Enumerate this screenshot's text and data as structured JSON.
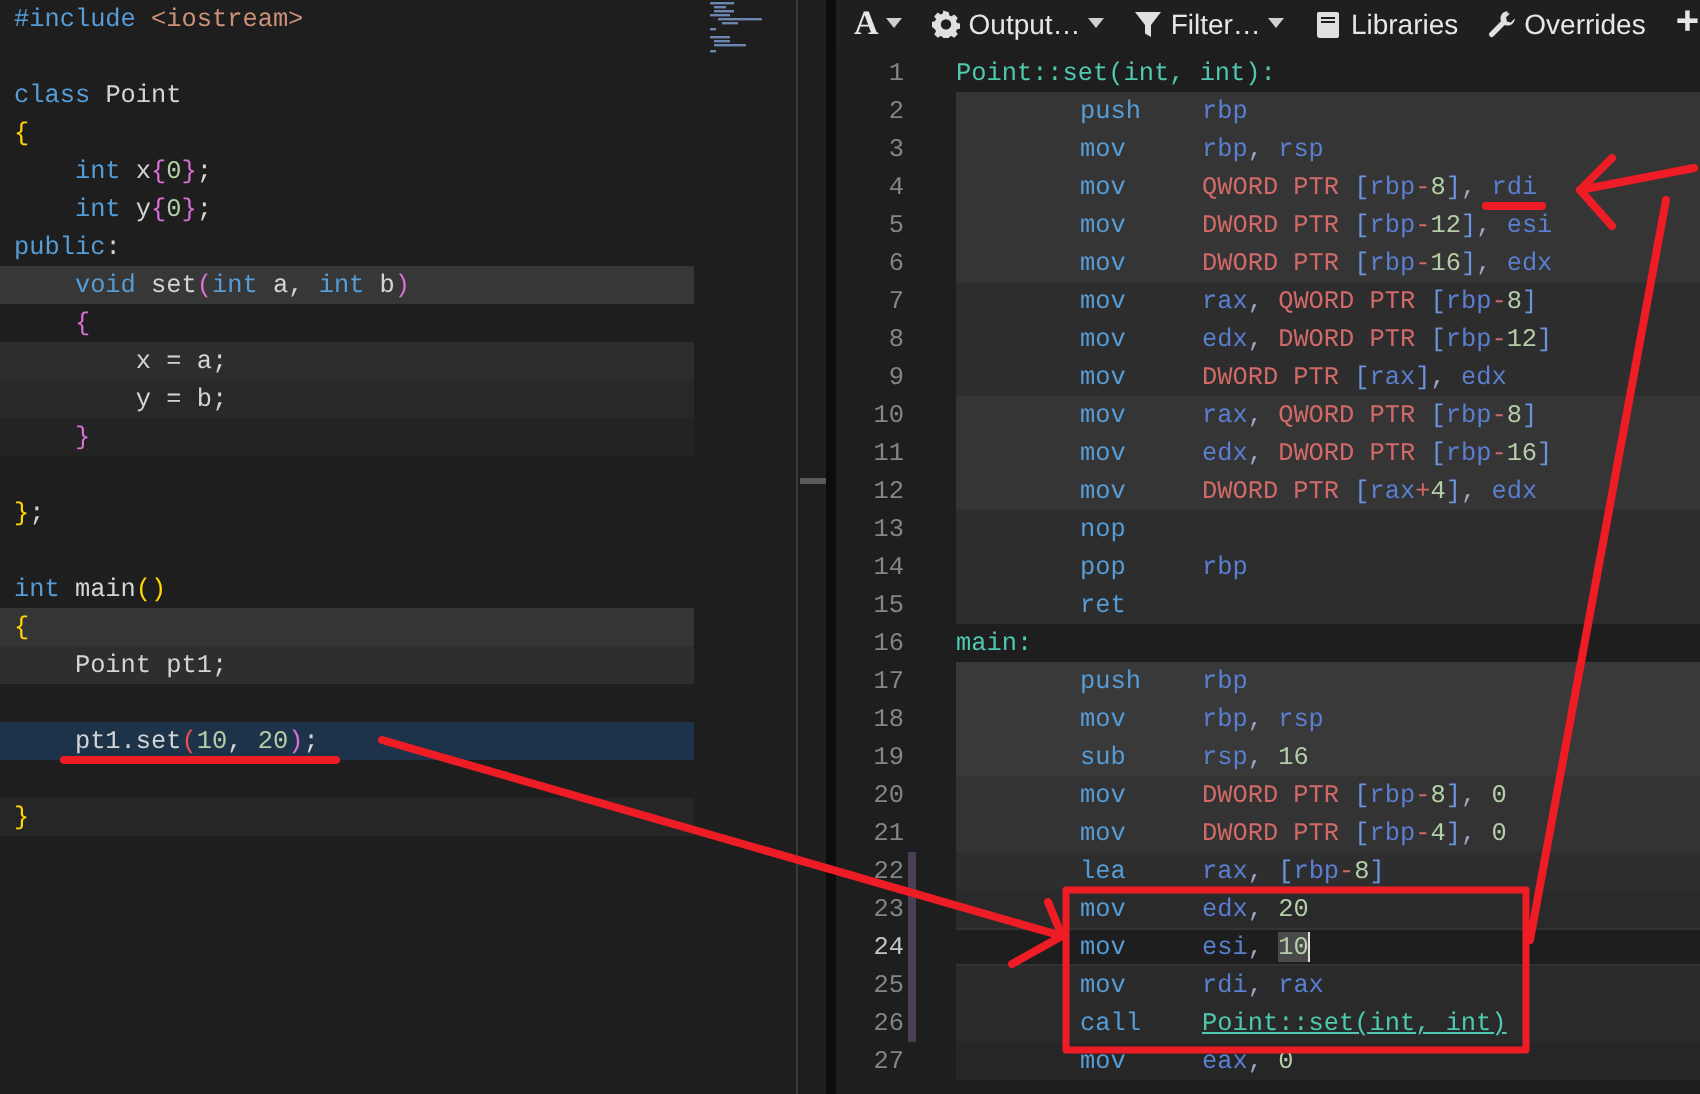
{
  "editor": {
    "lines": [
      {
        "selected": false,
        "tokens": [
          {
            "text": "#include",
            "kind": "kw"
          },
          {
            "text": " <iostream>",
            "kind": "inc"
          }
        ]
      },
      {
        "selected": false
      },
      {
        "selected": false,
        "tokens": [
          {
            "text": "class",
            "kind": "kw"
          },
          {
            "text": " Point",
            "kind": "plain"
          }
        ]
      },
      {
        "selected": false,
        "tokens": [
          {
            "text": "{",
            "kind": "gold"
          }
        ]
      },
      {
        "selected": false,
        "tokens": [
          {
            "text": "    int",
            "kind": "kw"
          },
          {
            "text": " x",
            "kind": "plain"
          },
          {
            "text": "{",
            "kind": "pink"
          },
          {
            "text": "0",
            "kind": "num"
          },
          {
            "text": "}",
            "kind": "pink"
          },
          {
            "text": ";",
            "kind": "plain"
          }
        ]
      },
      {
        "selected": false,
        "tokens": [
          {
            "text": "    int",
            "kind": "kw"
          },
          {
            "text": " y",
            "kind": "plain"
          },
          {
            "text": "{",
            "kind": "pink"
          },
          {
            "text": "0",
            "kind": "num"
          },
          {
            "text": "}",
            "kind": "pink"
          },
          {
            "text": ";",
            "kind": "plain"
          }
        ]
      },
      {
        "selected": false,
        "tokens": [
          {
            "text": "public",
            "kind": "kw"
          },
          {
            "text": ":",
            "kind": "plain"
          }
        ]
      },
      {
        "selected": false,
        "color": "#373737",
        "tokens": [
          {
            "text": "    void",
            "kind": "kw"
          },
          {
            "text": " set",
            "kind": "plain"
          },
          {
            "text": "(",
            "kind": "pink"
          },
          {
            "text": "int",
            "kind": "kw"
          },
          {
            "text": " a, ",
            "kind": "plain"
          },
          {
            "text": "int",
            "kind": "kw"
          },
          {
            "text": " b",
            "kind": "plain"
          },
          {
            "text": ")",
            "kind": "pink"
          }
        ]
      },
      {
        "selected": false,
        "tokens": [
          {
            "text": "    {",
            "kind": "pink"
          }
        ]
      },
      {
        "selected": false,
        "color": "#2d2d2d",
        "tokens": [
          {
            "text": "        x = a;",
            "kind": "plain"
          }
        ]
      },
      {
        "selected": false,
        "color": "#282828",
        "tokens": [
          {
            "text": "        y = b;",
            "kind": "plain"
          }
        ]
      },
      {
        "selected": false,
        "color": "#232323",
        "tokens": [
          {
            "text": "    }",
            "kind": "pink"
          }
        ]
      },
      {
        "selected": false
      },
      {
        "selected": false,
        "tokens": [
          {
            "text": "}",
            "kind": "gold"
          },
          {
            "text": ";",
            "kind": "plain"
          }
        ]
      },
      {
        "selected": false
      },
      {
        "selected": false,
        "tokens": [
          {
            "text": "int",
            "kind": "kw"
          },
          {
            "text": " main",
            "kind": "plain"
          },
          {
            "text": "()",
            "kind": "gold"
          }
        ]
      },
      {
        "selected": false,
        "color": "#353535",
        "tokens": [
          {
            "text": "{",
            "kind": "gold"
          }
        ]
      },
      {
        "selected": false,
        "color": "#2e2e2e",
        "tokens": [
          {
            "text": "    Point pt1;",
            "kind": "plain"
          }
        ]
      },
      {
        "selected": false
      },
      {
        "selected": true,
        "tokens": [
          {
            "text": "    pt1.set",
            "kind": "plain"
          },
          {
            "text": "(",
            "kind": "red"
          },
          {
            "text": "10",
            "kind": "num"
          },
          {
            "text": ", ",
            "kind": "plain"
          },
          {
            "text": "20",
            "kind": "num"
          },
          {
            "text": ")",
            "kind": "pink"
          },
          {
            "text": ";",
            "kind": "plain"
          }
        ]
      },
      {
        "selected": false
      },
      {
        "selected": false,
        "color": "#262626",
        "tokens": [
          {
            "text": "}",
            "kind": "gold"
          }
        ]
      }
    ]
  },
  "output": {
    "toolbar": [
      {
        "label": "A",
        "kind": "font",
        "dropdown": true
      },
      {
        "label": "Output…",
        "kind": "output",
        "dropdown": true
      },
      {
        "label": "Filter…",
        "kind": "filter",
        "dropdown": true
      },
      {
        "label": "Libraries",
        "kind": "libraries",
        "dropdown": false
      },
      {
        "label": "Overrides",
        "kind": "overrides",
        "dropdown": false
      },
      {
        "label": "+",
        "kind": "add",
        "dropdown": false
      }
    ],
    "lines": [
      {
        "number": "1",
        "kind": "label",
        "selected": false,
        "marked": false,
        "text": "Point::set(int, int):"
      },
      {
        "number": "2",
        "kind": "instruction",
        "selected": false,
        "marked": false,
        "color": "#353535",
        "mnemonic": "push",
        "args": [
          {
            "text": "rbp",
            "kind": "reg"
          }
        ]
      },
      {
        "number": "3",
        "kind": "instruction",
        "selected": false,
        "marked": false,
        "color": "#353535",
        "mnemonic": "mov",
        "args": [
          {
            "text": "rbp",
            "kind": "reg"
          },
          {
            "text": ", ",
            "kind": "plain"
          },
          {
            "text": "rsp",
            "kind": "reg"
          }
        ]
      },
      {
        "number": "4",
        "kind": "instruction",
        "selected": false,
        "marked": false,
        "color": "#353535",
        "mnemonic": "mov",
        "args": [
          {
            "text": "QWORD PTR ",
            "kind": "ptr"
          },
          {
            "text": "[",
            "kind": "bracket"
          },
          {
            "text": "rbp",
            "kind": "reg"
          },
          {
            "text": "-",
            "kind": "op"
          },
          {
            "text": "8",
            "kind": "num"
          },
          {
            "text": "]",
            "kind": "bracket"
          },
          {
            "text": ", ",
            "kind": "plain"
          },
          {
            "text": "rdi",
            "kind": "reg"
          }
        ]
      },
      {
        "number": "5",
        "kind": "instruction",
        "selected": false,
        "marked": false,
        "color": "#353535",
        "mnemonic": "mov",
        "args": [
          {
            "text": "DWORD PTR ",
            "kind": "ptr"
          },
          {
            "text": "[",
            "kind": "bracket"
          },
          {
            "text": "rbp",
            "kind": "reg"
          },
          {
            "text": "-",
            "kind": "op"
          },
          {
            "text": "12",
            "kind": "num"
          },
          {
            "text": "]",
            "kind": "bracket"
          },
          {
            "text": ", ",
            "kind": "plain"
          },
          {
            "text": "esi",
            "kind": "reg"
          }
        ]
      },
      {
        "number": "6",
        "kind": "instruction",
        "selected": false,
        "marked": false,
        "color": "#353535",
        "mnemonic": "mov",
        "args": [
          {
            "text": "DWORD PTR ",
            "kind": "ptr"
          },
          {
            "text": "[",
            "kind": "bracket"
          },
          {
            "text": "rbp",
            "kind": "reg"
          },
          {
            "text": "-",
            "kind": "op"
          },
          {
            "text": "16",
            "kind": "num"
          },
          {
            "text": "]",
            "kind": "bracket"
          },
          {
            "text": ", ",
            "kind": "plain"
          },
          {
            "text": "edx",
            "kind": "reg"
          }
        ]
      },
      {
        "number": "7",
        "kind": "instruction",
        "selected": false,
        "marked": false,
        "color": "#2d2d2d",
        "mnemonic": "mov",
        "args": [
          {
            "text": "rax",
            "kind": "reg"
          },
          {
            "text": ", ",
            "kind": "plain"
          },
          {
            "text": "QWORD PTR ",
            "kind": "ptr"
          },
          {
            "text": "[",
            "kind": "bracket"
          },
          {
            "text": "rbp",
            "kind": "reg"
          },
          {
            "text": "-",
            "kind": "op"
          },
          {
            "text": "8",
            "kind": "num"
          },
          {
            "text": "]",
            "kind": "bracket"
          }
        ]
      },
      {
        "number": "8",
        "kind": "instruction",
        "selected": false,
        "marked": false,
        "color": "#2d2d2d",
        "mnemonic": "mov",
        "args": [
          {
            "text": "edx",
            "kind": "reg"
          },
          {
            "text": ", ",
            "kind": "plain"
          },
          {
            "text": "DWORD PTR ",
            "kind": "ptr"
          },
          {
            "text": "[",
            "kind": "bracket"
          },
          {
            "text": "rbp",
            "kind": "reg"
          },
          {
            "text": "-",
            "kind": "op"
          },
          {
            "text": "12",
            "kind": "num"
          },
          {
            "text": "]",
            "kind": "bracket"
          }
        ]
      },
      {
        "number": "9",
        "kind": "instruction",
        "selected": false,
        "marked": false,
        "color": "#2d2d2d",
        "mnemonic": "mov",
        "args": [
          {
            "text": "DWORD PTR ",
            "kind": "ptr"
          },
          {
            "text": "[",
            "kind": "bracket"
          },
          {
            "text": "rax",
            "kind": "reg"
          },
          {
            "text": "]",
            "kind": "bracket"
          },
          {
            "text": ", ",
            "kind": "plain"
          },
          {
            "text": "edx",
            "kind": "reg"
          }
        ]
      },
      {
        "number": "10",
        "kind": "instruction",
        "selected": false,
        "marked": false,
        "color": "#353535",
        "mnemonic": "mov",
        "args": [
          {
            "text": "rax",
            "kind": "reg"
          },
          {
            "text": ", ",
            "kind": "plain"
          },
          {
            "text": "QWORD PTR ",
            "kind": "ptr"
          },
          {
            "text": "[",
            "kind": "bracket"
          },
          {
            "text": "rbp",
            "kind": "reg"
          },
          {
            "text": "-",
            "kind": "op"
          },
          {
            "text": "8",
            "kind": "num"
          },
          {
            "text": "]",
            "kind": "bracket"
          }
        ]
      },
      {
        "number": "11",
        "kind": "instruction",
        "selected": false,
        "marked": false,
        "color": "#353535",
        "mnemonic": "mov",
        "args": [
          {
            "text": "edx",
            "kind": "reg"
          },
          {
            "text": ", ",
            "kind": "plain"
          },
          {
            "text": "DWORD PTR ",
            "kind": "ptr"
          },
          {
            "text": "[",
            "kind": "bracket"
          },
          {
            "text": "rbp",
            "kind": "reg"
          },
          {
            "text": "-",
            "kind": "op"
          },
          {
            "text": "16",
            "kind": "num"
          },
          {
            "text": "]",
            "kind": "bracket"
          }
        ]
      },
      {
        "number": "12",
        "kind": "instruction",
        "selected": false,
        "marked": false,
        "color": "#353535",
        "mnemonic": "mov",
        "args": [
          {
            "text": "DWORD PTR ",
            "kind": "ptr"
          },
          {
            "text": "[",
            "kind": "bracket"
          },
          {
            "text": "rax",
            "kind": "reg"
          },
          {
            "text": "+",
            "kind": "op"
          },
          {
            "text": "4",
            "kind": "num"
          },
          {
            "text": "]",
            "kind": "bracket"
          },
          {
            "text": ", ",
            "kind": "plain"
          },
          {
            "text": "edx",
            "kind": "reg"
          }
        ]
      },
      {
        "number": "13",
        "kind": "instruction",
        "selected": false,
        "marked": false,
        "color": "#2d2d2d",
        "mnemonic": "nop"
      },
      {
        "number": "14",
        "kind": "instruction",
        "selected": false,
        "marked": false,
        "color": "#2d2d2d",
        "mnemonic": "pop",
        "args": [
          {
            "text": "rbp",
            "kind": "reg"
          }
        ]
      },
      {
        "number": "15",
        "kind": "instruction",
        "selected": false,
        "marked": false,
        "color": "#2d2d2d",
        "mnemonic": "ret"
      },
      {
        "number": "16",
        "kind": "label",
        "selected": false,
        "marked": false,
        "text": "main:"
      },
      {
        "number": "17",
        "kind": "instruction",
        "selected": false,
        "marked": false,
        "color": "#393939",
        "mnemonic": "push",
        "args": [
          {
            "text": "rbp",
            "kind": "reg"
          }
        ]
      },
      {
        "number": "18",
        "kind": "instruction",
        "selected": false,
        "marked": false,
        "color": "#393939",
        "mnemonic": "mov",
        "args": [
          {
            "text": "rbp",
            "kind": "reg"
          },
          {
            "text": ", ",
            "kind": "plain"
          },
          {
            "text": "rsp",
            "kind": "reg"
          }
        ]
      },
      {
        "number": "19",
        "kind": "instruction",
        "selected": false,
        "marked": false,
        "color": "#393939",
        "mnemonic": "sub",
        "args": [
          {
            "text": "rsp",
            "kind": "reg"
          },
          {
            "text": ", ",
            "kind": "plain"
          },
          {
            "text": "16",
            "kind": "num"
          }
        ]
      },
      {
        "number": "20",
        "kind": "instruction",
        "selected": false,
        "marked": false,
        "color": "#333333",
        "mnemonic": "mov",
        "args": [
          {
            "text": "DWORD PTR ",
            "kind": "ptr"
          },
          {
            "text": "[",
            "kind": "bracket"
          },
          {
            "text": "rbp",
            "kind": "reg"
          },
          {
            "text": "-",
            "kind": "op"
          },
          {
            "text": "8",
            "kind": "num"
          },
          {
            "text": "]",
            "kind": "bracket"
          },
          {
            "text": ", ",
            "kind": "plain"
          },
          {
            "text": "0",
            "kind": "num"
          }
        ]
      },
      {
        "number": "21",
        "kind": "instruction",
        "selected": false,
        "marked": false,
        "color": "#333333",
        "mnemonic": "mov",
        "args": [
          {
            "text": "DWORD PTR ",
            "kind": "ptr"
          },
          {
            "text": "[",
            "kind": "bracket"
          },
          {
            "text": "rbp",
            "kind": "reg"
          },
          {
            "text": "-",
            "kind": "op"
          },
          {
            "text": "4",
            "kind": "num"
          },
          {
            "text": "]",
            "kind": "bracket"
          },
          {
            "text": ", ",
            "kind": "plain"
          },
          {
            "text": "0",
            "kind": "num"
          }
        ]
      },
      {
        "number": "22",
        "kind": "instruction",
        "selected": false,
        "marked": true,
        "color": "#2e2e2e",
        "mnemonic": "lea",
        "args": [
          {
            "text": "rax",
            "kind": "reg"
          },
          {
            "text": ", ",
            "kind": "plain"
          },
          {
            "text": "[",
            "kind": "bracket"
          },
          {
            "text": "rbp",
            "kind": "reg"
          },
          {
            "text": "-",
            "kind": "op"
          },
          {
            "text": "8",
            "kind": "num"
          },
          {
            "text": "]",
            "kind": "bracket"
          }
        ]
      },
      {
        "number": "23",
        "kind": "instruction",
        "selected": false,
        "marked": true,
        "color": "#2a2a2a",
        "mnemonic": "mov",
        "args": [
          {
            "text": "edx",
            "kind": "reg"
          },
          {
            "text": ", ",
            "kind": "plain"
          },
          {
            "text": "20",
            "kind": "num"
          }
        ]
      },
      {
        "number": "24",
        "kind": "instruction",
        "selected": true,
        "marked": true,
        "mnemonic": "mov",
        "args": [
          {
            "text": "esi",
            "kind": "reg"
          },
          {
            "text": ", ",
            "kind": "plain"
          },
          {
            "text": "10",
            "kind": "cursor"
          }
        ]
      },
      {
        "number": "25",
        "kind": "instruction",
        "selected": false,
        "marked": true,
        "color": "#2a2a2a",
        "mnemonic": "mov",
        "args": [
          {
            "text": "rdi",
            "kind": "reg"
          },
          {
            "text": ", ",
            "kind": "plain"
          },
          {
            "text": "rax",
            "kind": "reg"
          }
        ]
      },
      {
        "number": "26",
        "kind": "instruction",
        "selected": false,
        "marked": true,
        "color": "#2a2a2a",
        "mnemonic": "call",
        "args": [
          {
            "text": "Point::set(int, int)",
            "kind": "link"
          }
        ]
      },
      {
        "number": "27",
        "kind": "instruction",
        "selected": false,
        "marked": false,
        "color": "#262626",
        "mnemonic": "mov",
        "args": [
          {
            "text": "eax",
            "kind": "reg"
          },
          {
            "text": ", ",
            "kind": "plain"
          },
          {
            "text": "0",
            "kind": "num"
          }
        ]
      }
    ]
  }
}
